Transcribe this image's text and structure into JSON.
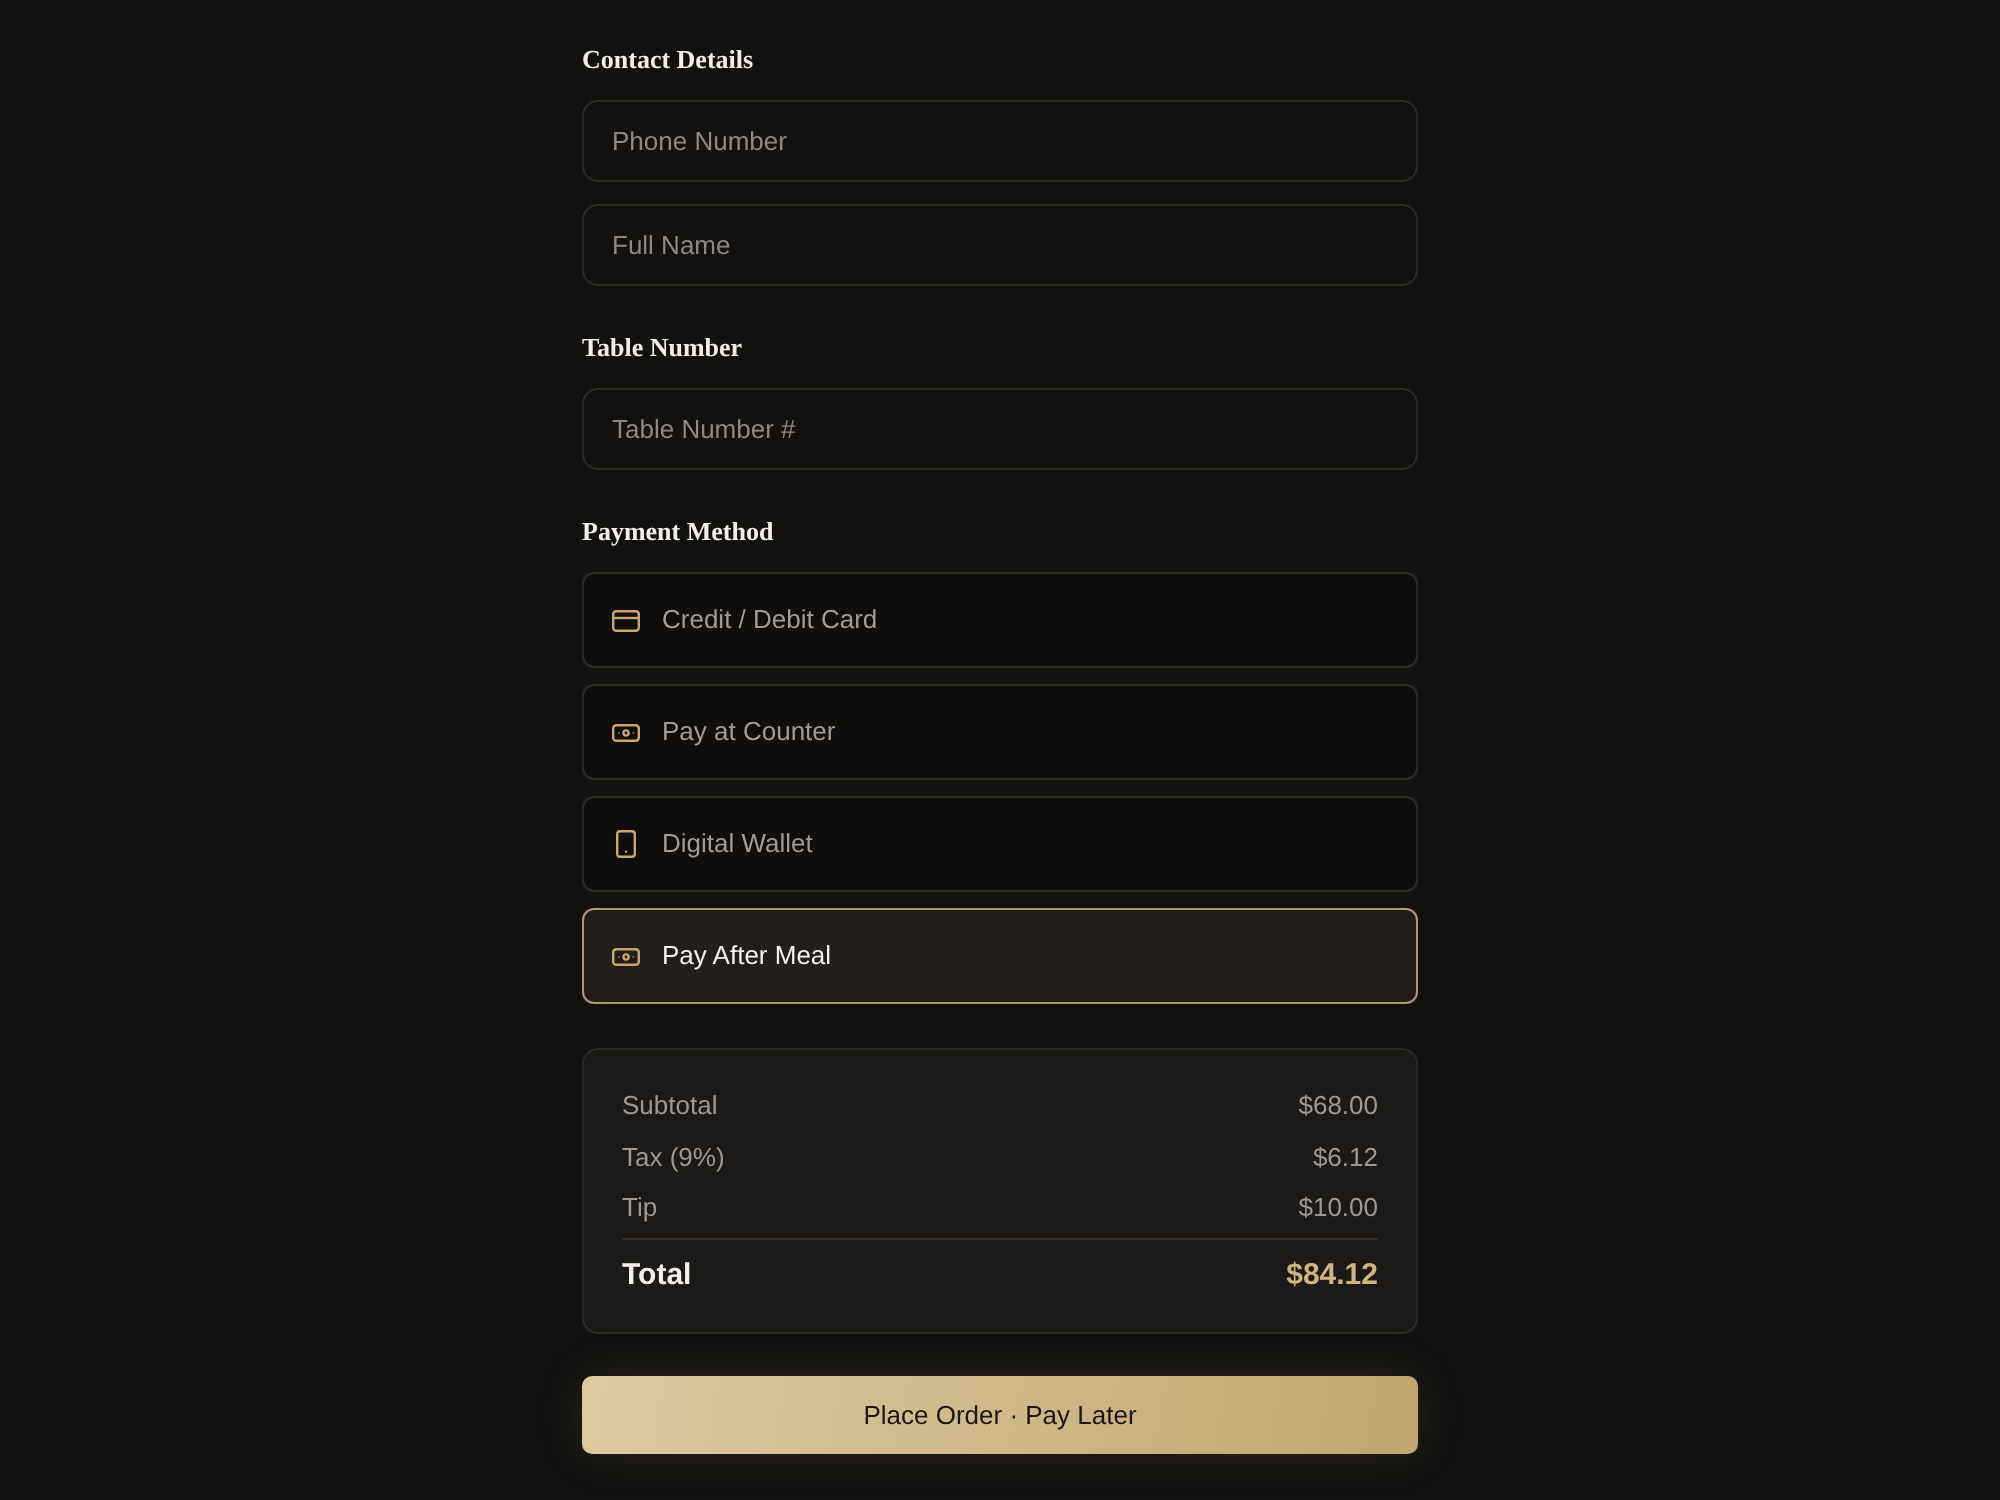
{
  "sections": [
    {
      "heading": "Contact Details",
      "fields": [
        {
          "placeholder": "Phone Number"
        },
        {
          "placeholder": "Full Name"
        }
      ]
    },
    {
      "heading": "Table Number",
      "fields": [
        {
          "placeholder": "Table Number #"
        }
      ]
    }
  ],
  "payment": {
    "heading": "Payment Method",
    "options": [
      {
        "kind": "card",
        "label": "Credit / Debit Card",
        "selected": false
      },
      {
        "kind": "cash",
        "label": "Pay at Counter",
        "selected": false
      },
      {
        "kind": "phone",
        "label": "Digital Wallet",
        "selected": false
      },
      {
        "kind": "cash",
        "label": "Pay After Meal",
        "selected": true
      }
    ]
  },
  "summary": {
    "rows": [
      {
        "label": "Subtotal",
        "value": "$68.00"
      },
      {
        "label": "Tax (9%)",
        "value": "$6.12"
      },
      {
        "label": "Tip",
        "value": "$10.00"
      }
    ],
    "total": {
      "label": "Total",
      "value": "$84.12"
    }
  },
  "submit": {
    "label": "Place Order · Pay Later"
  }
}
